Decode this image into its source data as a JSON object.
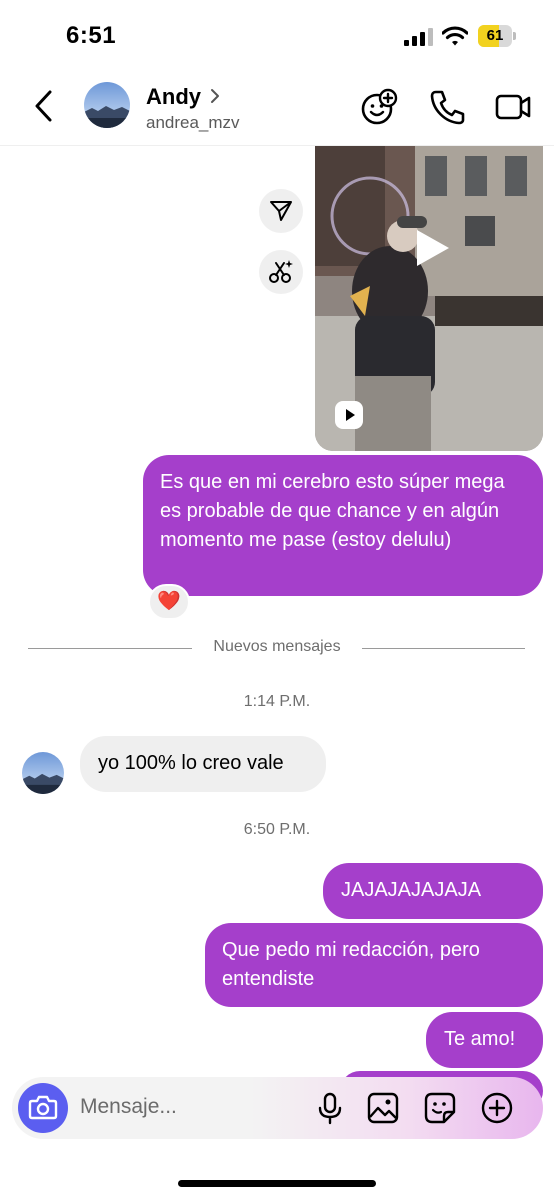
{
  "status_bar": {
    "time": "6:51",
    "battery": "61",
    "battery_level": 0.61
  },
  "header": {
    "contact_name": "Andy",
    "username": "andrea_mzv",
    "icons": [
      "back-chevron-icon",
      "avatar",
      "effects-smiley-icon",
      "phone-icon",
      "video-camera-icon"
    ]
  },
  "chat": {
    "video_icons": [
      "play-icon",
      "reel-icon"
    ],
    "side_actions": [
      "share-icon",
      "cut-sparkle-icon"
    ],
    "messages": {
      "m1": "Es que en mi cerebro esto súper mega es probable de que chance y en algún momento me pase (estoy delulu)",
      "m1_reaction": "❤️",
      "divider": "Nuevos mensajes",
      "time1": "1:14 P.M.",
      "m2": "yo 100% lo creo vale",
      "time2": "6:50 P.M.",
      "m3": "JAJAJAJAJAJA",
      "m4": "Que pedo mi redacción, pero entendiste",
      "m5": "Te amo!"
    }
  },
  "composer": {
    "placeholder": "Mensaje...",
    "icons": [
      "camera-icon",
      "microphone-icon",
      "image-icon",
      "sticker-icon",
      "plus-icon"
    ]
  },
  "colors": {
    "outgoing": "#a53fcb",
    "incoming": "#efefef",
    "camera": "#5b5ef0",
    "battery": "#f2d21f"
  }
}
